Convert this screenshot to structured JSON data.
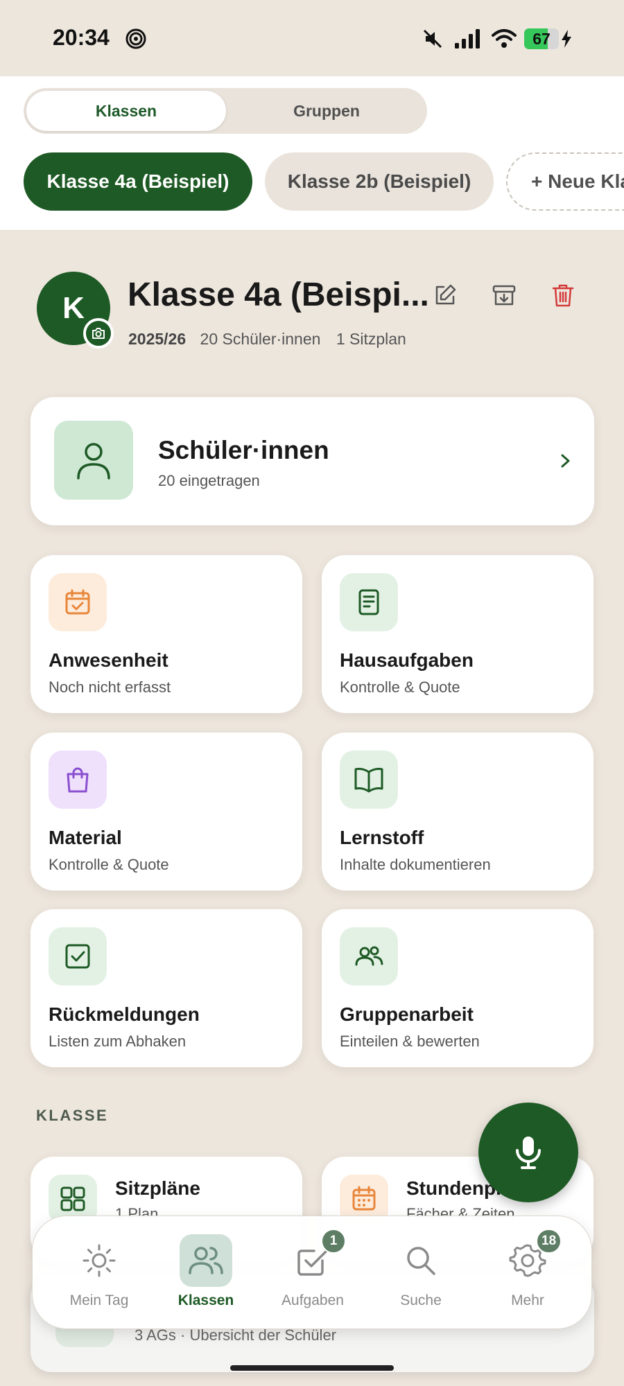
{
  "status_bar": {
    "time": "20:34",
    "battery_level": "67",
    "icons": [
      "hotspot-icon",
      "mute-icon",
      "signal-icon",
      "wifi-icon",
      "battery-icon",
      "charging-icon"
    ]
  },
  "top_segment": {
    "options": [
      "Klassen",
      "Gruppen"
    ],
    "selected": "Klassen"
  },
  "class_chips": [
    "Klasse 4a (Beispiel)",
    "Klasse 2b (Beispiel)",
    "+ Neue Kla"
  ],
  "class_header": {
    "avatar_letter": "K",
    "title": "Klasse 4a (Beispi...",
    "school_year": "2025/26",
    "students_count": "20 Schüler·innen",
    "seating": "1 Sitzplan"
  },
  "students_card": {
    "title": "Schüler·innen",
    "subtitle": "20 eingetragen"
  },
  "tiles": [
    {
      "title": "Anwesenheit",
      "subtitle": "Noch nicht erfasst"
    },
    {
      "title": "Hausaufgaben",
      "subtitle": "Kontrolle & Quote"
    },
    {
      "title": "Material",
      "subtitle": "Kontrolle & Quote"
    },
    {
      "title": "Lernstoff",
      "subtitle": "Inhalte dokumentieren"
    },
    {
      "title": "Rückmeldungen",
      "subtitle": "Listen zum Abhaken"
    },
    {
      "title": "Gruppenarbeit",
      "subtitle": "Einteilen & bewerten"
    }
  ],
  "section_label": "KLASSE",
  "klasse_tiles": [
    {
      "title": "Sitzpläne",
      "subtitle": "1 Plan"
    },
    {
      "title": "Stundenpläne",
      "subtitle": "Fächer & Zeiten"
    }
  ],
  "behind_card": {
    "subtitle": "3 AGs · Übersicht der Schüler"
  },
  "bottom_nav": [
    {
      "label": "Mein Tag",
      "icon": "sun-icon"
    },
    {
      "label": "Klassen",
      "icon": "users-icon",
      "active": true
    },
    {
      "label": "Aufgaben",
      "icon": "task-check-icon",
      "badge": "1"
    },
    {
      "label": "Suche",
      "icon": "search-icon"
    },
    {
      "label": "Mehr",
      "icon": "settings-gear-icon",
      "badge": "18"
    }
  ],
  "colors": {
    "primary_green": "#1e5a25",
    "background": "#ede6dd",
    "delete_red": "#d33a3a",
    "orange_accent": "#e8863a",
    "purple_accent": "#8a4fd1"
  }
}
